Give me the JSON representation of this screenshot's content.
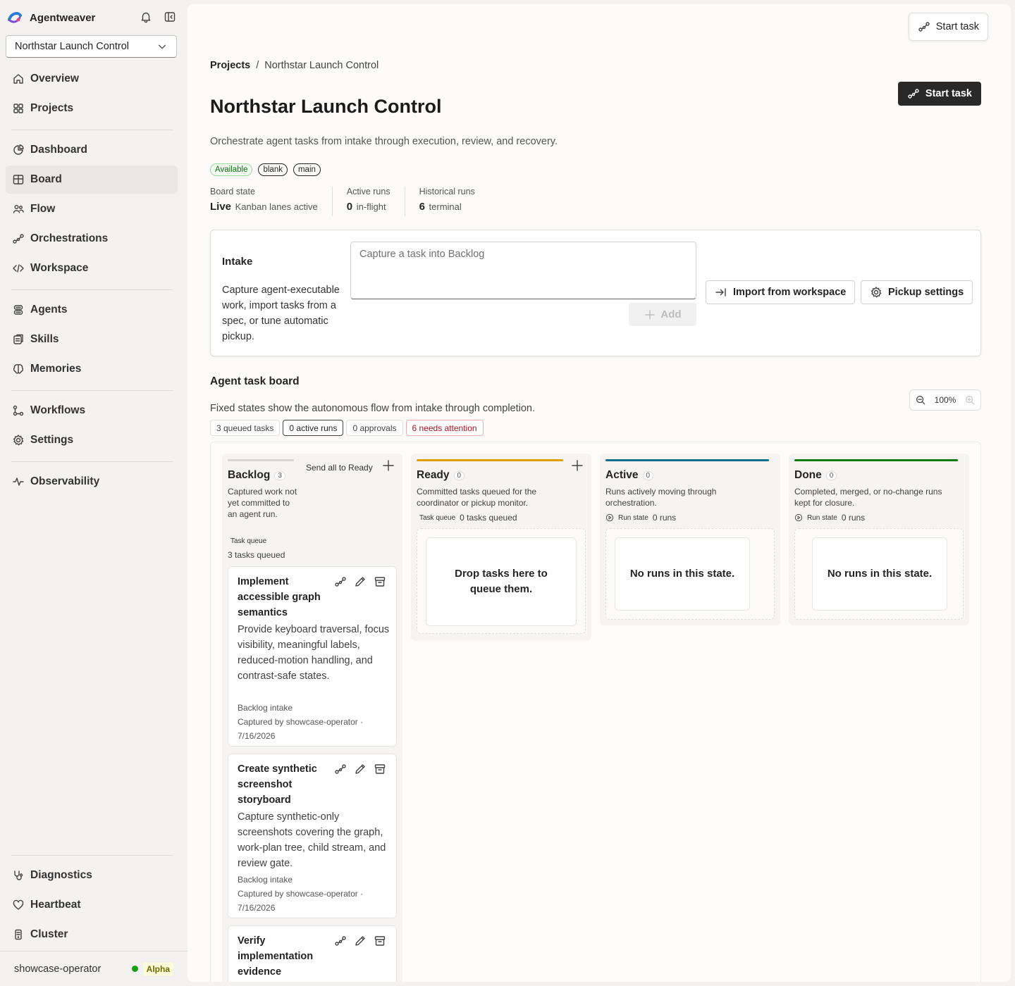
{
  "app": {
    "name": "Agentweaver"
  },
  "sidebar": {
    "project": "Northstar Launch Control",
    "items": [
      {
        "label": "Overview"
      },
      {
        "label": "Projects"
      },
      {
        "label": "Dashboard"
      },
      {
        "label": "Board"
      },
      {
        "label": "Flow"
      },
      {
        "label": "Orchestrations"
      },
      {
        "label": "Workspace"
      },
      {
        "label": "Agents"
      },
      {
        "label": "Skills"
      },
      {
        "label": "Memories"
      },
      {
        "label": "Workflows"
      },
      {
        "label": "Settings"
      },
      {
        "label": "Observability"
      },
      {
        "label": "Diagnostics"
      },
      {
        "label": "Heartbeat"
      },
      {
        "label": "Cluster"
      }
    ],
    "user": "showcase-operator",
    "badge": "Alpha"
  },
  "header": {
    "top_button": "Start task",
    "breadcrumb_root": "Projects",
    "breadcrumb_sep": "/",
    "breadcrumb_current": "Northstar Launch Control",
    "title": "Northstar Launch Control",
    "start_button": "Start task",
    "description": "Orchestrate agent tasks from intake through execution, review, and recovery.",
    "tags": [
      "Available",
      "blank",
      "main"
    ],
    "stats": [
      {
        "label": "Board state",
        "value": "Live",
        "unit": "Kanban lanes active"
      },
      {
        "label": "Active runs",
        "value": "0",
        "unit": "in-flight"
      },
      {
        "label": "Historical runs",
        "value": "6",
        "unit": "terminal"
      }
    ]
  },
  "intake": {
    "title": "Intake",
    "description": "Capture agent-executable work, import tasks from a spec, or tune automatic pickup.",
    "placeholder": "Capture a task into Backlog",
    "add_label": "Add",
    "import_label": "Import from workspace",
    "settings_label": "Pickup settings"
  },
  "board": {
    "title": "Agent task board",
    "description": "Fixed states show the autonomous flow from intake through completion.",
    "zoom": "100%",
    "chips": [
      "3 queued tasks",
      "0 active runs",
      "0 approvals",
      "6 needs attention"
    ],
    "colors": {
      "backlog": "#d6d6d6",
      "ready": "#e0a000",
      "active": "#0f6f8c",
      "done": "#107c10"
    },
    "lanes": {
      "backlog": {
        "name": "Backlog",
        "count": "3",
        "action": "Send all to Ready",
        "description": "Captured work not yet committed to an agent run.",
        "meta_label": "Task queue",
        "meta_value": "3 tasks queued",
        "tasks": [
          {
            "title": "Implement accessible graph semantics",
            "description": "Provide keyboard traversal, focus visibility, meaningful labels, reduced-motion handling, and contrast-safe states.",
            "source": "Backlog intake",
            "by": "Captured by showcase-operator · 7/16/2026"
          },
          {
            "title": "Create synthetic screenshot storyboard",
            "description": "Capture synthetic-only screenshots covering the graph, work-plan tree, child stream, and review gate.",
            "source": "Backlog intake",
            "by": "Captured by showcase-operator · 7/16/2026"
          },
          {
            "title": "Verify implementation evidence"
          }
        ]
      },
      "ready": {
        "name": "Ready",
        "count": "0",
        "description": "Committed tasks queued for the coordinator or pickup monitor.",
        "meta_label": "Task queue",
        "meta_value": "0 tasks queued",
        "empty": "Drop tasks here to queue them."
      },
      "active": {
        "name": "Active",
        "count": "0",
        "description": "Runs actively moving through orchestration.",
        "meta_label": "Run state",
        "meta_value": "0 runs",
        "empty": "No runs in this state."
      },
      "done": {
        "name": "Done",
        "count": "0",
        "description": "Completed, merged, or no-change runs kept for closure.",
        "meta_label": "Run state",
        "meta_value": "0 runs",
        "empty": "No runs in this state."
      }
    }
  }
}
